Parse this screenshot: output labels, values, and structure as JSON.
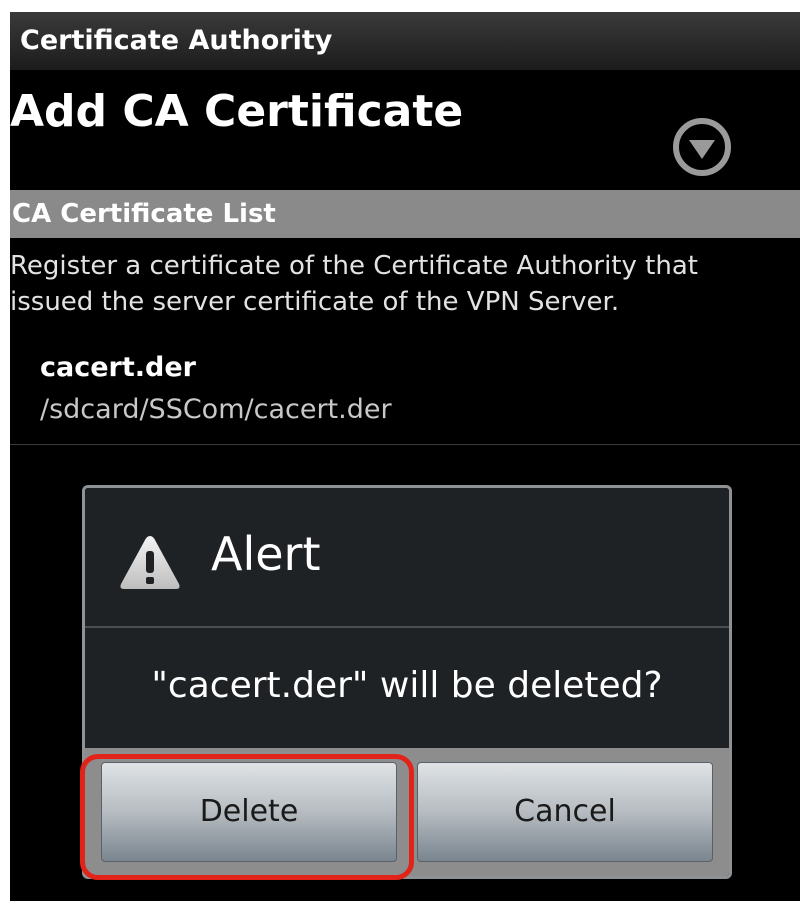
{
  "app": {
    "title": "Certificate Authority"
  },
  "header": {
    "title": "Add CA Certificate",
    "toggle_icon": "chevron-down-circle-icon"
  },
  "section": {
    "title": "CA Certificate List",
    "description_line1": "Register a certificate of the Certificate Authority that",
    "description_line2": "issued the server certificate of the VPN Server."
  },
  "certificates": [
    {
      "name": "cacert.der",
      "path": "/sdcard/SSCom/cacert.der"
    }
  ],
  "dialog": {
    "icon": "warning-triangle-icon",
    "title": "Alert",
    "message": "\"cacert.der\" will be deleted?",
    "delete_label": "Delete",
    "cancel_label": "Cancel"
  },
  "colors": {
    "highlight": "#e2231a",
    "section_header_bg": "#8a8a8a",
    "dialog_bg": "#1e2225"
  }
}
